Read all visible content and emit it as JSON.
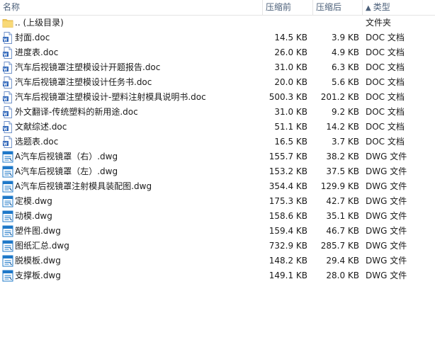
{
  "header": {
    "name": "名称",
    "size": "压缩前",
    "packed": "压缩后",
    "type": "类型",
    "sort_arrow": "▲"
  },
  "rows": [
    {
      "icon": "folder-icon",
      "name": ".. (上级目录)",
      "size": "",
      "packed": "",
      "type": "文件夹"
    },
    {
      "icon": "doc-file-icon",
      "name": "封面.doc",
      "size": "14.5 KB",
      "packed": "3.9 KB",
      "type": "DOC 文档"
    },
    {
      "icon": "doc-file-icon",
      "name": " 进度表.doc",
      "size": "26.0 KB",
      "packed": "4.9 KB",
      "type": "DOC 文档"
    },
    {
      "icon": "doc-file-icon",
      "name": "汽车后视镜罩注塑模设计开题报告.doc",
      "size": "31.0 KB",
      "packed": "6.3 KB",
      "type": "DOC 文档"
    },
    {
      "icon": "doc-file-icon",
      "name": "汽车后视镜罩注塑模设计任务书.doc",
      "size": "20.0 KB",
      "packed": "5.6 KB",
      "type": "DOC 文档"
    },
    {
      "icon": "doc-file-icon",
      "name": "汽车后视镜罩注塑模设计-塑料注射模具说明书.doc",
      "size": "500.3 KB",
      "packed": "201.2 KB",
      "type": "DOC 文档"
    },
    {
      "icon": "doc-file-icon",
      "name": "外文翻译-传统塑料的新用途.doc",
      "size": "31.0 KB",
      "packed": "9.2 KB",
      "type": "DOC 文档"
    },
    {
      "icon": "doc-file-icon",
      "name": "文献综述.doc",
      "size": "51.1 KB",
      "packed": "14.2 KB",
      "type": "DOC 文档"
    },
    {
      "icon": "doc-file-icon",
      "name": "选题表.doc",
      "size": "16.5 KB",
      "packed": "3.7 KB",
      "type": "DOC 文档"
    },
    {
      "icon": "dwg-file-icon",
      "name": "A汽车后视镜罩（右）.dwg",
      "size": "155.7 KB",
      "packed": "38.2 KB",
      "type": "DWG 文件"
    },
    {
      "icon": "dwg-file-icon",
      "name": "A汽车后视镜罩（左）.dwg",
      "size": "153.2 KB",
      "packed": "37.5 KB",
      "type": "DWG 文件"
    },
    {
      "icon": "dwg-file-icon",
      "name": "A汽车后视镜罩注射模具装配图.dwg",
      "size": "354.4 KB",
      "packed": "129.9 KB",
      "type": "DWG 文件"
    },
    {
      "icon": "dwg-file-icon",
      "name": "定模.dwg",
      "size": "175.3 KB",
      "packed": "42.7 KB",
      "type": "DWG 文件"
    },
    {
      "icon": "dwg-file-icon",
      "name": "动模.dwg",
      "size": "158.6 KB",
      "packed": "35.1 KB",
      "type": "DWG 文件"
    },
    {
      "icon": "dwg-file-icon",
      "name": "塑件图.dwg",
      "size": "159.4 KB",
      "packed": "46.7 KB",
      "type": "DWG 文件"
    },
    {
      "icon": "dwg-file-icon",
      "name": "图纸汇总.dwg",
      "size": "732.9 KB",
      "packed": "285.7 KB",
      "type": "DWG 文件"
    },
    {
      "icon": "dwg-file-icon",
      "name": "脱模板.dwg",
      "size": "148.2 KB",
      "packed": "29.4 KB",
      "type": "DWG 文件"
    },
    {
      "icon": "dwg-file-icon",
      "name": "支撑板.dwg",
      "size": "149.1 KB",
      "packed": "28.0 KB",
      "type": "DWG 文件"
    }
  ],
  "colors": {
    "header_text": "#4c607a",
    "folder": "#f4cc5e",
    "doc_blue": "#2b63b8",
    "dwg_blue": "#1e78c8"
  }
}
